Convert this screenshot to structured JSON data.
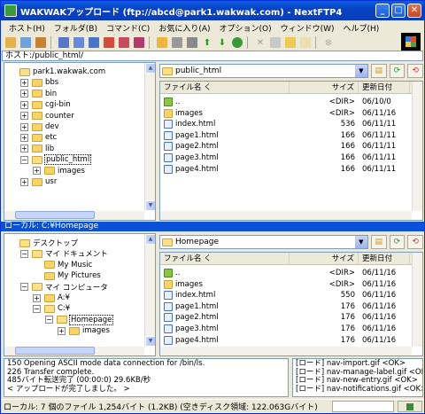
{
  "window": {
    "title": "WAKWAKアップロード (ftp://abcd@park1.wakwak.com) - NextFTP4",
    "buttons": {
      "minimize": "_",
      "maximize": "□",
      "close": "✕"
    }
  },
  "menu": [
    "ホスト(H)",
    "フォルダ(B)",
    "コマンド(C)",
    "お気に入り(A)",
    "オプション(O)",
    "ウィンドウ(W)",
    "ヘルプ(H)"
  ],
  "host_path": "ホスト:/public_html/",
  "remote": {
    "tree": [
      {
        "label": "park1.wakwak.com",
        "level": 0,
        "expander": "",
        "open": true
      },
      {
        "label": "bbs",
        "level": 1,
        "expander": "+"
      },
      {
        "label": "bin",
        "level": 1,
        "expander": "+"
      },
      {
        "label": "cgi-bin",
        "level": 1,
        "expander": "+"
      },
      {
        "label": "counter",
        "level": 1,
        "expander": "+"
      },
      {
        "label": "dev",
        "level": 1,
        "expander": "+"
      },
      {
        "label": "etc",
        "level": 1,
        "expander": "+"
      },
      {
        "label": "lib",
        "level": 1,
        "expander": "+"
      },
      {
        "label": "public_html",
        "level": 1,
        "expander": "−",
        "open": true,
        "selected": true
      },
      {
        "label": "images",
        "level": 2,
        "expander": "+"
      },
      {
        "label": "usr",
        "level": 1,
        "expander": "+"
      }
    ],
    "address": "public_html",
    "columns": {
      "name": "ファイル名 く",
      "size": "サイズ",
      "date": "更新日付"
    },
    "files": [
      {
        "name": "..",
        "size": "<DIR>",
        "date": "06/10/0",
        "type": "up"
      },
      {
        "name": "images",
        "size": "<DIR>",
        "date": "06/11/16",
        "type": "dir"
      },
      {
        "name": "index.html",
        "size": "536",
        "date": "06/11/11",
        "type": "file"
      },
      {
        "name": "page1.html",
        "size": "166",
        "date": "06/11/11",
        "type": "file"
      },
      {
        "name": "page2.html",
        "size": "166",
        "date": "06/11/11",
        "type": "file"
      },
      {
        "name": "page3.html",
        "size": "166",
        "date": "06/11/11",
        "type": "file"
      },
      {
        "name": "page4.html",
        "size": "166",
        "date": "06/11/11",
        "type": "file"
      }
    ]
  },
  "local_label": "ローカル: C:¥Homepage",
  "local": {
    "tree": [
      {
        "label": "デスクトップ",
        "level": 0,
        "expander": "",
        "open": true
      },
      {
        "label": "マイ ドキュメント",
        "level": 1,
        "expander": "−",
        "open": true
      },
      {
        "label": "My Music",
        "level": 2,
        "expander": ""
      },
      {
        "label": "My Pictures",
        "level": 2,
        "expander": ""
      },
      {
        "label": "マイ コンピュータ",
        "level": 1,
        "expander": "−",
        "open": true
      },
      {
        "label": "A:¥",
        "level": 2,
        "expander": "+"
      },
      {
        "label": "C:¥",
        "level": 2,
        "expander": "−",
        "open": true
      },
      {
        "label": "Homepage",
        "level": 3,
        "expander": "−",
        "open": true,
        "selected": true
      },
      {
        "label": "images",
        "level": 4,
        "expander": "+"
      }
    ],
    "address": "Homepage",
    "columns": {
      "name": "ファイル名 く",
      "size": "サイズ",
      "date": "更新日付"
    },
    "files": [
      {
        "name": "..",
        "size": "<DIR>",
        "date": "06/11/16",
        "type": "up"
      },
      {
        "name": "images",
        "size": "<DIR>",
        "date": "06/11/16",
        "type": "dir"
      },
      {
        "name": "index.html",
        "size": "550",
        "date": "06/11/16",
        "type": "file"
      },
      {
        "name": "page1.html",
        "size": "176",
        "date": "06/11/16",
        "type": "file"
      },
      {
        "name": "page2.html",
        "size": "176",
        "date": "06/11/16",
        "type": "file"
      },
      {
        "name": "page3.html",
        "size": "176",
        "date": "06/11/16",
        "type": "file"
      },
      {
        "name": "page4.html",
        "size": "176",
        "date": "06/11/16",
        "type": "file"
      }
    ]
  },
  "log": [
    "150 Opening ASCII mode data connection for /bin/ls.",
    "226 Transfer complete.",
    "485バイト転送完了 (00:00:0) 29.6KB/秒",
    "< アップロードが完了しました。 >"
  ],
  "queue": [
    "[ロード] nav-import.gif <OK>",
    "[ロード] nav-manage-label.gif <OK>",
    "[ロード] nav-new-entry.gif <OK>",
    "[ロード] nav-notifications.gif <OK>"
  ],
  "status": "ローカル: 7 個のファイル 1,254バイト (1.2KB) (空きディスク領域: 122.063Gバイト)"
}
